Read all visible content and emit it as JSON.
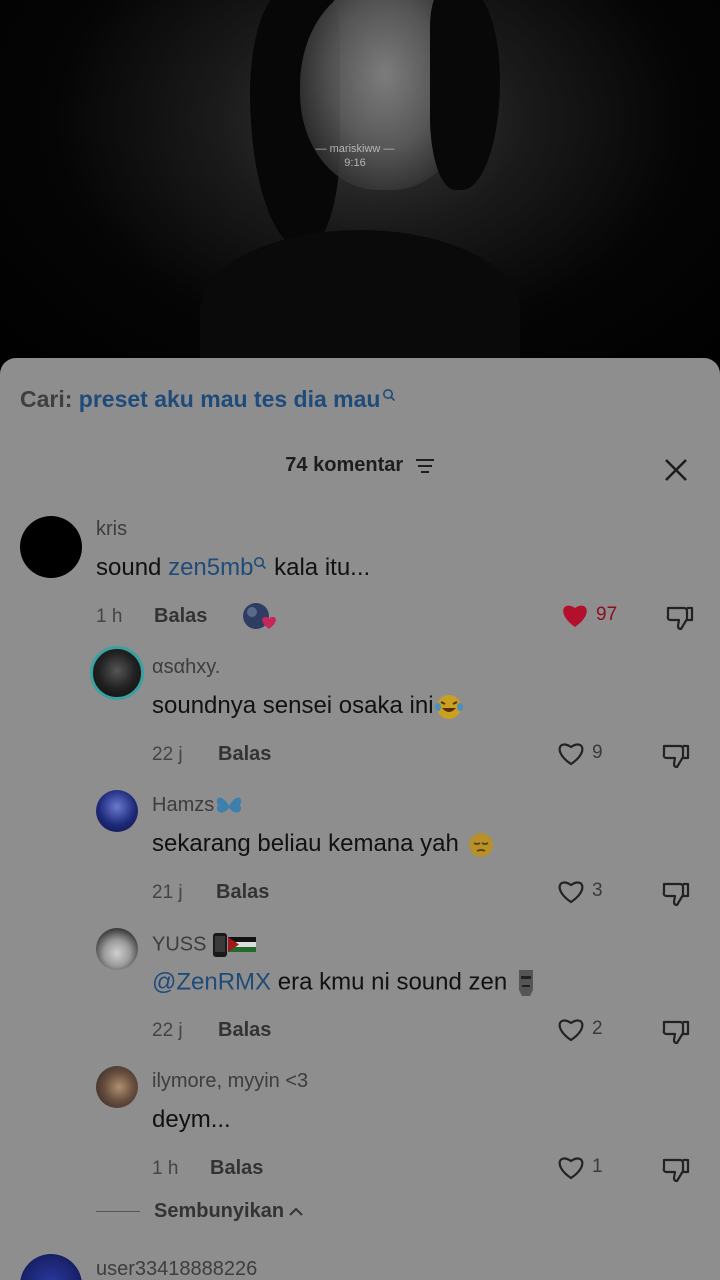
{
  "video": {
    "watermark_name": "— mariskiww —",
    "watermark_time": "9:16"
  },
  "search": {
    "prefix": "Cari:",
    "query": "preset aku mau tes dia mau"
  },
  "comments_header": {
    "count_label": "74 komentar"
  },
  "colors": {
    "link_blue": "#1f4b7a",
    "heart_red": "#b3102b",
    "sheet_bg": "#8e8e8e"
  },
  "comments": [
    {
      "username": "kris",
      "text_before": "sound ",
      "mention": "zen5mb",
      "text_after": " kala itu...",
      "time": "1 h",
      "reply": "Balas",
      "likes": "97",
      "liked": true
    },
    {
      "username": "αsαhxy.",
      "text": "soundnya sensei osaka ini",
      "emoji": "laughing-tears",
      "time": "22 j",
      "reply": "Balas",
      "likes": "9",
      "liked": false
    },
    {
      "username": "Hamzs",
      "username_emoji": "butterfly",
      "text": "sekarang beliau kemana yah ",
      "emoji": "pensive-face",
      "time": "21 j",
      "reply": "Balas",
      "likes": "3",
      "liked": false
    },
    {
      "username": "YUSS",
      "username_emoji": "phone-and-flag",
      "mention": "@ZenRMX",
      "text": " era kmu ni sound zen",
      "emoji": "moai",
      "time": "22 j",
      "reply": "Balas",
      "likes": "2",
      "liked": false
    },
    {
      "username": "ilymore, myyin <3",
      "text": "deym...",
      "time": "1 h",
      "reply": "Balas",
      "likes": "1",
      "liked": false
    }
  ],
  "hide_replies": {
    "label": "Sembunyikan"
  },
  "next_comment": {
    "username": "user33418888226"
  }
}
